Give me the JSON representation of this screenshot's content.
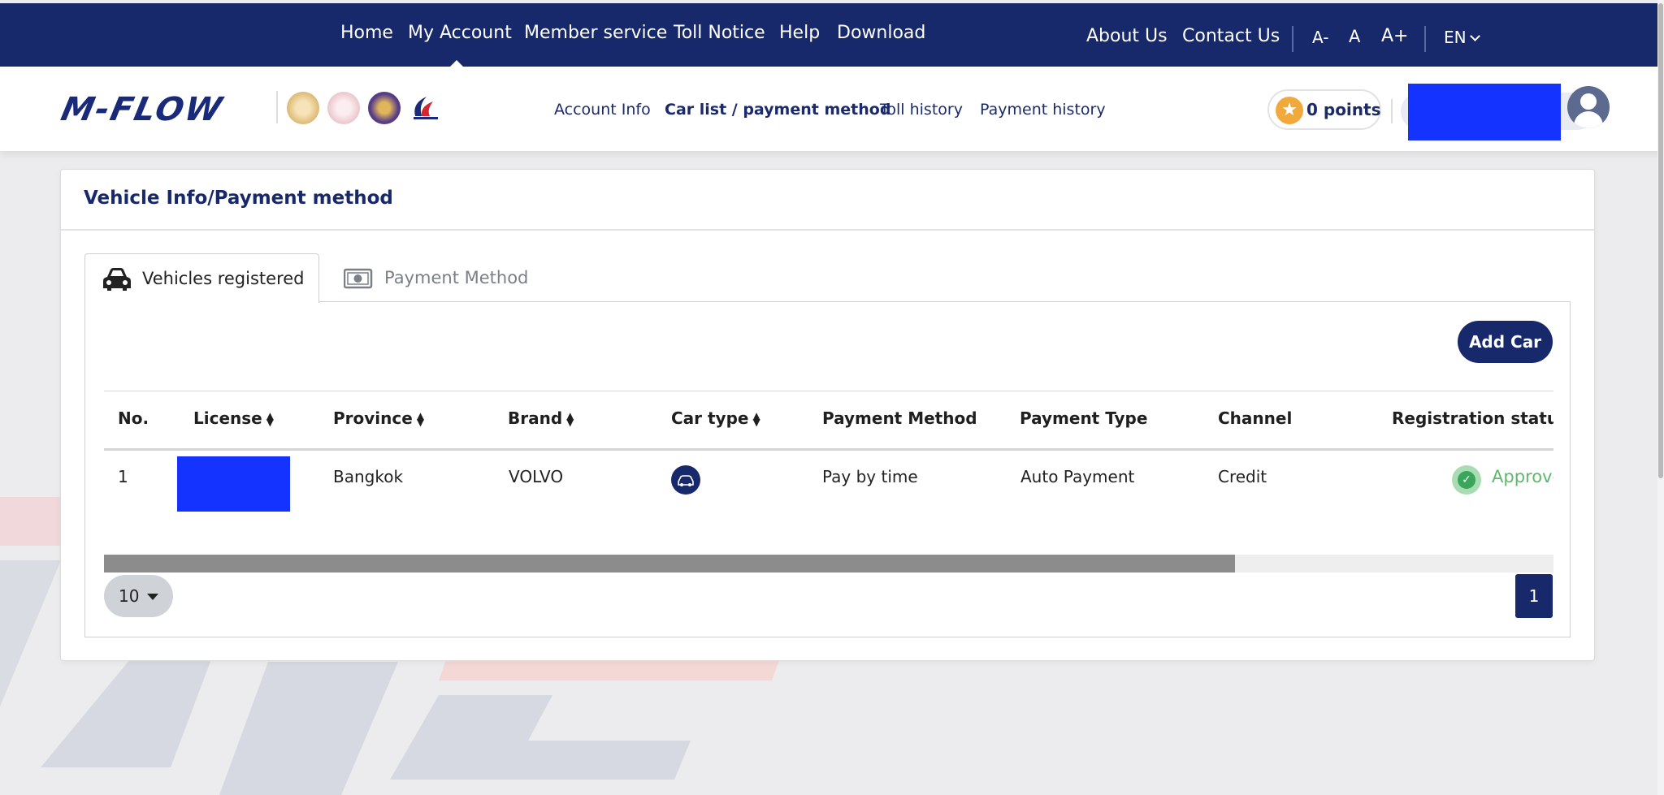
{
  "top_nav": {
    "items": [
      "Home",
      "My Account",
      "Member service",
      "Toll Notice",
      "Help",
      "Download"
    ],
    "right_items": [
      "About Us",
      "Contact Us"
    ],
    "font_controls": [
      "A-",
      "A",
      "A+"
    ],
    "language": "EN"
  },
  "header": {
    "logo_text": "M-FLOW",
    "subnav": [
      "Account Info",
      "Car list / payment method",
      "Toll history",
      "Payment history"
    ],
    "active_subnav": "Car list / payment method",
    "points_label": "0 points"
  },
  "card": {
    "title": "Vehicle Info/Payment method",
    "tabs": [
      "Vehicles registered",
      "Payment Method"
    ],
    "add_car_label": "Add Car",
    "table": {
      "headers": [
        "No.",
        "License",
        "Province",
        "Brand",
        "Car type",
        "Payment Method",
        "Payment Type",
        "Channel",
        "Registration status"
      ],
      "rows": [
        {
          "no": "1",
          "province": "Bangkok",
          "brand": "VOLVO",
          "payment_method": "Pay by time",
          "payment_type": "Auto Payment",
          "channel": "Credit",
          "status": "Approved"
        }
      ]
    },
    "horizontal_scroll_fraction": 0.78,
    "page_size": "10",
    "current_page": "1"
  },
  "colors": {
    "navy": "#17296b",
    "approved_green": "#5cb86c",
    "points_star": "#f2a93b"
  }
}
